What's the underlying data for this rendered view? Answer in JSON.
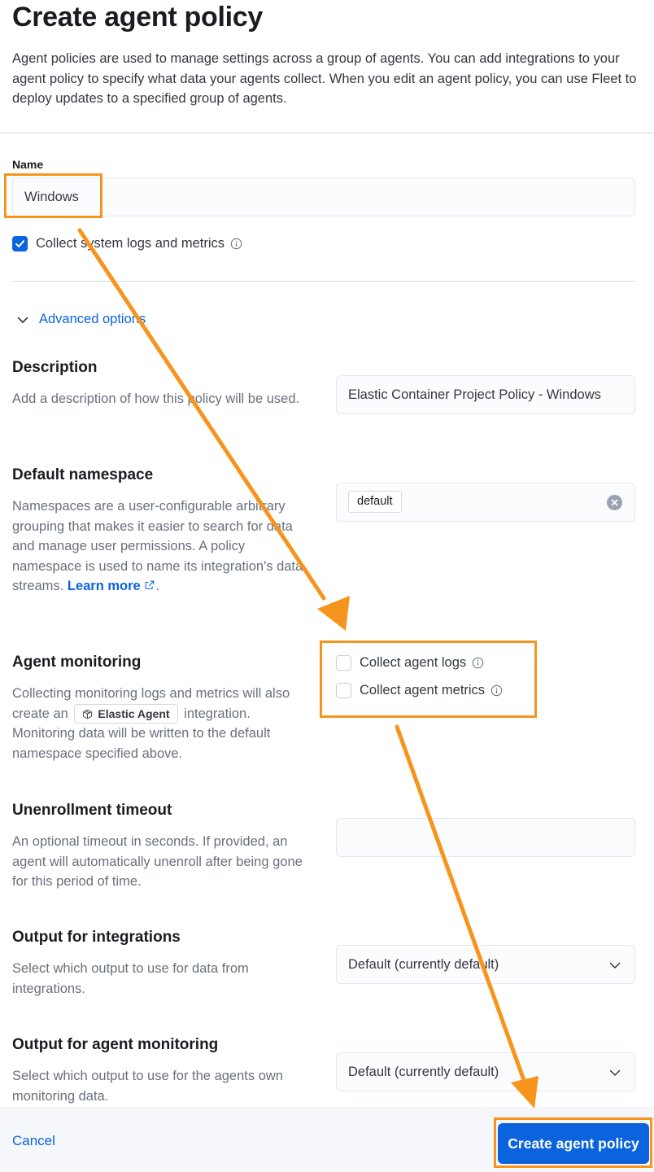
{
  "header": {
    "title": "Create agent policy",
    "intro": "Agent policies are used to manage settings across a group of agents. You can add integrations to your agent policy to specify what data your agents collect. When you edit an agent policy, you can use Fleet to deploy updates to a specified group of agents."
  },
  "name_field": {
    "label": "Name",
    "value": "Windows"
  },
  "system_checkbox": {
    "label": "Collect system logs and metrics",
    "checked": true
  },
  "advanced": {
    "toggle_label": "Advanced options",
    "expanded": true
  },
  "description": {
    "title": "Description",
    "help": "Add a description of how this policy will be used.",
    "value": "Elastic Container Project Policy - Windows"
  },
  "namespace": {
    "title": "Default namespace",
    "help": "Namespaces are a user-configurable arbitrary grouping that makes it easier to search for data and manage user permissions. A policy namespace is used to name its integration's data streams. ",
    "link_label": "Learn more",
    "trailing": ".",
    "value": "default"
  },
  "monitoring": {
    "title": "Agent monitoring",
    "help_before": "Collecting monitoring logs and metrics will also create an",
    "badge": "Elastic Agent",
    "help_after": "integration. Monitoring data will be written to the default namespace specified above.",
    "options": [
      {
        "label": "Collect agent logs",
        "checked": false
      },
      {
        "label": "Collect agent metrics",
        "checked": false
      }
    ]
  },
  "unenrollment": {
    "title": "Unenrollment timeout",
    "help": "An optional timeout in seconds. If provided, an agent will automatically unenroll after being gone for this period of time.",
    "value": ""
  },
  "output_integrations": {
    "title": "Output for integrations",
    "help": "Select which output to use for data from integrations.",
    "selected": "Default (currently default)"
  },
  "output_monitoring": {
    "title": "Output for agent monitoring",
    "help": "Select which output to use for the agents own monitoring data.",
    "selected": "Default (currently default)"
  },
  "footer": {
    "cancel_label": "Cancel",
    "create_label": "Create agent policy"
  },
  "colors": {
    "accent": "#0b64dd",
    "annotation": "#f7941d"
  }
}
